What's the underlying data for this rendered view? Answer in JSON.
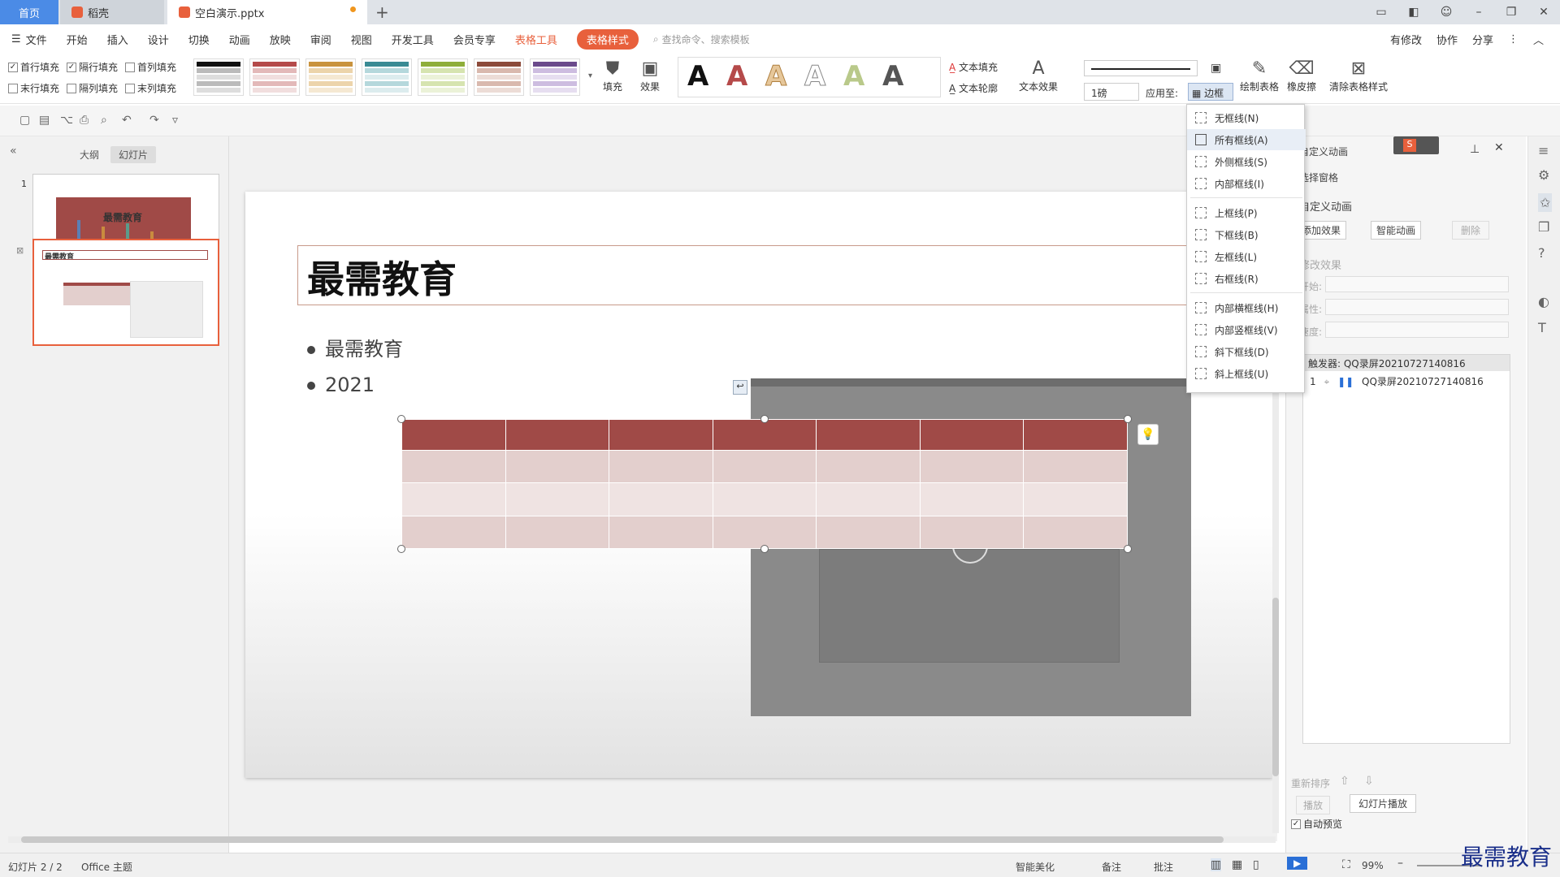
{
  "tabs": {
    "home": "首页",
    "daoke": "稻壳",
    "doc": "空白演示.pptx"
  },
  "menu": {
    "file": "文件",
    "start": "开始",
    "insert": "插入",
    "design": "设计",
    "transition": "切换",
    "animation": "动画",
    "slideshow": "放映",
    "review": "审阅",
    "view": "视图",
    "devtools": "开发工具",
    "member": "会员专享",
    "table_tools": "表格工具",
    "table_style": "表格样式",
    "search_placeholder": "查找命令、搜索模板",
    "modified": "有修改",
    "collab": "协作",
    "share": "分享"
  },
  "ribbon": {
    "first_row_fill": "首行填充",
    "banded_row_fill": "隔行填充",
    "first_col_fill": "首列填充",
    "last_row_fill": "末行填充",
    "banded_col_fill": "隔列填充",
    "last_col_fill": "末列填充",
    "fill": "填充",
    "effect": "效果",
    "text_fill": "文本填充",
    "text_outline": "文本轮廓",
    "text_effect": "文本效果",
    "line_weight": "1磅",
    "apply_to": "应用至:",
    "border": "边框",
    "draw_table": "绘制表格",
    "eraser": "橡皮擦",
    "clear_style": "清除表格样式",
    "first_row_checked": true,
    "banded_row_checked": true
  },
  "border_menu": [
    {
      "label": "无框线(N)",
      "highlight": false
    },
    {
      "label": "所有框线(A)",
      "highlight": true
    },
    {
      "label": "外侧框线(S)",
      "highlight": false
    },
    {
      "label": "内部框线(I)",
      "highlight": false
    },
    {
      "label": "上框线(P)",
      "highlight": false
    },
    {
      "label": "下框线(B)",
      "highlight": false
    },
    {
      "label": "左框线(L)",
      "highlight": false
    },
    {
      "label": "右框线(R)",
      "highlight": false
    },
    {
      "label": "内部横框线(H)",
      "highlight": false
    },
    {
      "label": "内部竖框线(V)",
      "highlight": false
    },
    {
      "label": "斜下框线(D)",
      "highlight": false
    },
    {
      "label": "斜上框线(U)",
      "highlight": false
    }
  ],
  "left_panel": {
    "outline": "大纲",
    "slides": "幻灯片",
    "slide1_num": "1",
    "slide1_title": "最需教育",
    "slide2_title": "最需教育"
  },
  "slide": {
    "title": "最需教育",
    "bullet1": "最需教育",
    "bullet2": "2021"
  },
  "right_panel": {
    "custom_anim": "自定义动画",
    "select_pane": "选择窗格",
    "custom_anim2": "自定义动画",
    "add_effect": "添加效果",
    "smart_anim": "智能动画",
    "delete": "删除",
    "modify_effect": "修改效果",
    "start": "开始:",
    "property": "属性:",
    "speed": "速度:",
    "trigger": "触发器: QQ录屏20210727140816",
    "item_num": "1",
    "item_name": "QQ录屏20210727140816",
    "reorder": "重新排序",
    "play": "播放",
    "slideshow": "幻灯片播放",
    "autopreview": "自动预览"
  },
  "status": {
    "slide_count": "幻灯片 2 / 2",
    "theme": "Office 主题",
    "beautify": "智能美化",
    "notes": "备注",
    "comments": "批注",
    "zoom": "99%"
  },
  "watermark": "最需教育",
  "colors": {
    "accent": "#e8603c",
    "table_header": "#a04a47",
    "tab_home": "#4b8be6"
  }
}
